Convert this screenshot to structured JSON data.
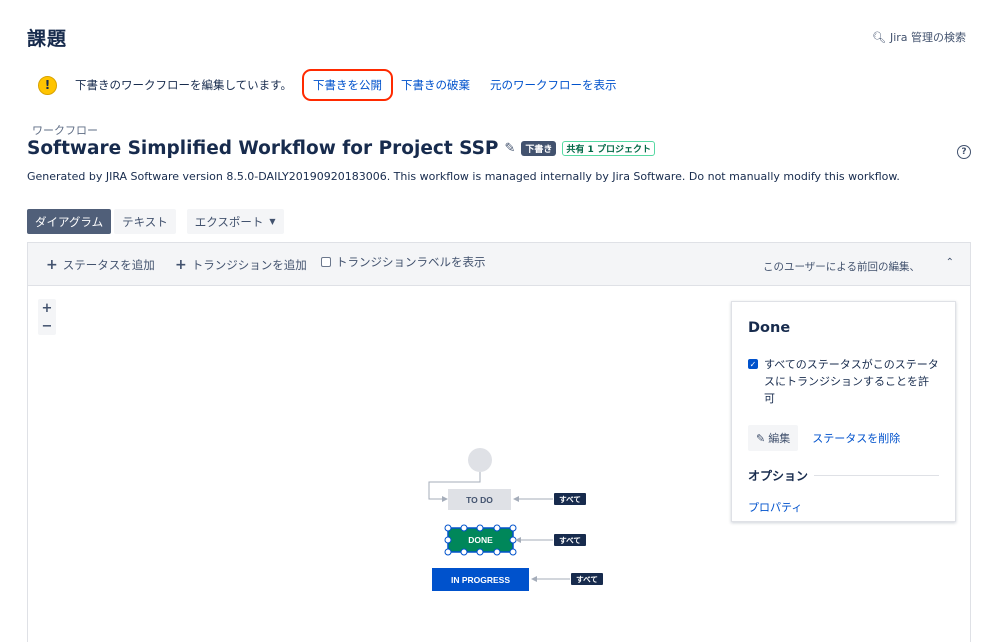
{
  "page": {
    "title": "課題",
    "admin_search": "Jira 管理の検索"
  },
  "draft_bar": {
    "message": "下書きのワークフローを編集しています。",
    "publish": "下書きを公開",
    "discard": "下書きの破棄",
    "view_original": "元のワークフローを表示"
  },
  "workflow": {
    "section_label": "ワークフロー",
    "name": "Software Simplified Workflow for Project SSP",
    "draft_badge": "下書き",
    "shared_badge": "共有 1 プロジェクト",
    "description": "Generated by JIRA Software version 8.5.0-DAILY20190920183006. This workflow is managed internally by Jira Software. Do not manually modify this workflow."
  },
  "view_tabs": {
    "diagram": "ダイアグラム",
    "text": "テキスト",
    "export": "エクスポート"
  },
  "toolbar": {
    "add_status": "ステータスを追加",
    "add_transition": "トランジションを追加",
    "show_labels": "トランジションラベルを表示",
    "last_edit": "このユーザーによる前回の編集、"
  },
  "zoom": {
    "in": "+",
    "out": "−"
  },
  "diagram": {
    "statuses": [
      {
        "label": "TO DO",
        "color": "#dfe1e6",
        "text_color": "#42526e"
      },
      {
        "label": "DONE",
        "color": "#00875a",
        "text_color": "#ffffff"
      },
      {
        "label": "IN PROGRESS",
        "color": "#0052cc",
        "text_color": "#ffffff"
      }
    ],
    "all_label": "すべて",
    "start_color": "#dfe1e6"
  },
  "panel": {
    "title": "Done",
    "allow_all": "すべてのステータスがこのステータスにトランジションすることを許可",
    "edit": "編集",
    "delete_status": "ステータスを削除",
    "options_heading": "オプション",
    "properties": "プロパティ"
  },
  "colors": {
    "accent": "#0052cc",
    "warning": "#ffc400",
    "highlight": "#ff2a00"
  }
}
